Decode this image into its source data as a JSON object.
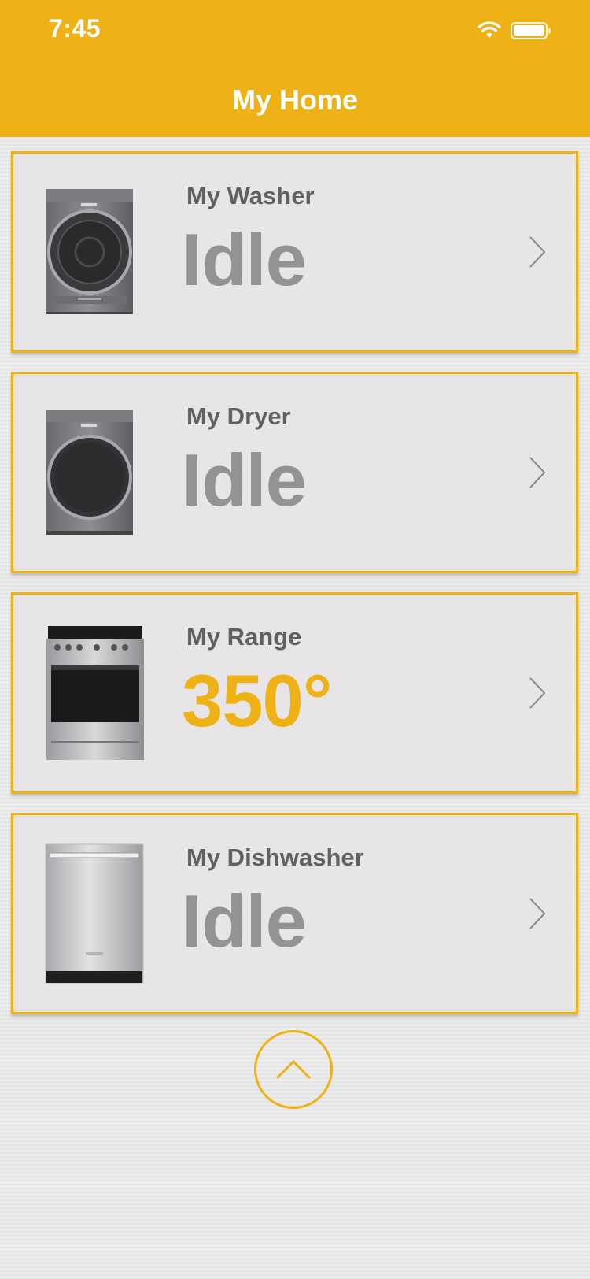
{
  "status_bar": {
    "time": "7:45",
    "icons": [
      "wifi-icon",
      "battery-icon"
    ]
  },
  "header": {
    "title": "My Home"
  },
  "appliances": [
    {
      "name": "My Washer",
      "status": "Idle",
      "icon": "washer-image",
      "active": false
    },
    {
      "name": "My Dryer",
      "status": "Idle",
      "icon": "dryer-image",
      "active": false
    },
    {
      "name": "My Range",
      "status": "350°",
      "icon": "range-image",
      "active": true
    },
    {
      "name": "My Dishwasher",
      "status": "Idle",
      "icon": "dishwasher-image",
      "active": false
    }
  ],
  "collapse_button": {
    "icon": "chevron-up-icon"
  },
  "colors": {
    "accent": "#eeb116",
    "card_bg": "#e7e5e6",
    "status_idle": "#939393",
    "label": "#606060"
  }
}
